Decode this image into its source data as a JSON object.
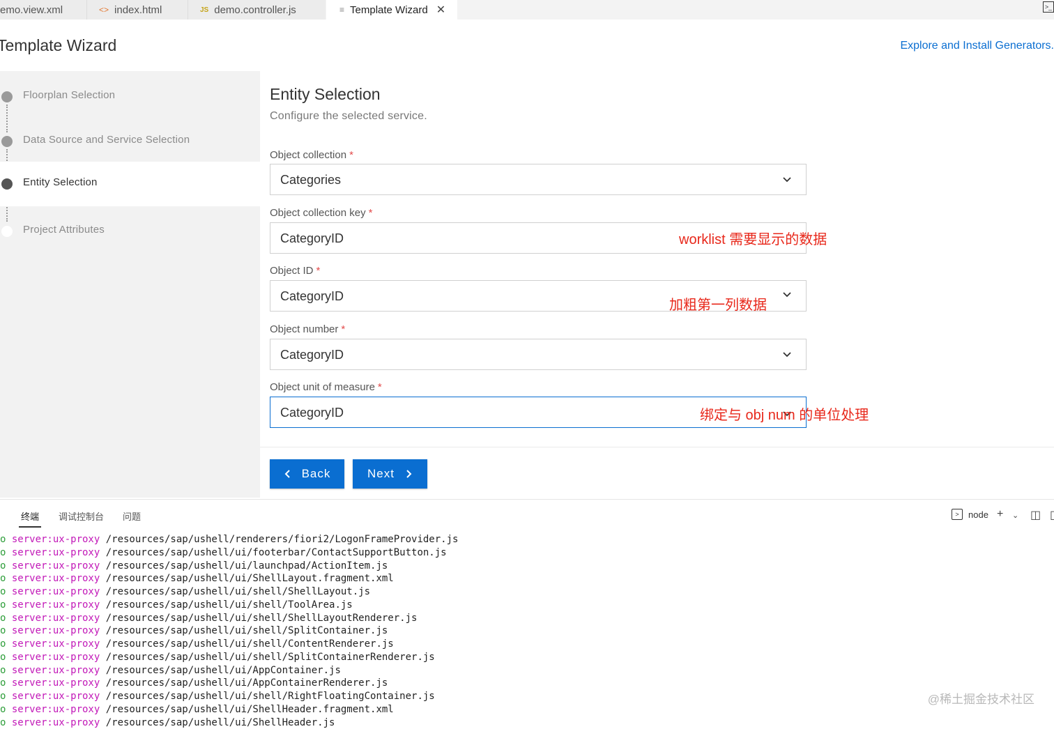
{
  "tabs": [
    {
      "label": "emo.view.xml",
      "icon": "xml-file-icon",
      "active": false
    },
    {
      "label": "index.html",
      "icon": "html-file-icon",
      "glyph": "<>",
      "active": false
    },
    {
      "label": "demo.controller.js",
      "icon": "js-file-icon",
      "glyph": "JS",
      "active": false
    },
    {
      "label": "Template Wizard",
      "icon": "wizard-file-icon",
      "glyph": "≡",
      "active": true
    }
  ],
  "header": {
    "title": "Template Wizard",
    "explore_link": "Explore and Install Generators."
  },
  "steps": [
    {
      "label": "Floorplan Selection",
      "state": "done"
    },
    {
      "label": "Data Source and Service Selection",
      "state": "done"
    },
    {
      "label": "Entity Selection",
      "state": "current"
    },
    {
      "label": "Project Attributes",
      "state": "pending"
    }
  ],
  "main": {
    "title": "Entity Selection",
    "subtitle": "Configure the selected service.",
    "fields": [
      {
        "label": "Object collection",
        "value": "Categories",
        "dropdown": true
      },
      {
        "label": "Object collection key",
        "value": "CategoryID",
        "dropdown": false
      },
      {
        "label": "Object ID",
        "value": "CategoryID",
        "dropdown": true
      },
      {
        "label": "Object number",
        "value": "CategoryID",
        "dropdown": true
      },
      {
        "label": "Object unit of measure",
        "value": "CategoryID",
        "dropdown": true
      }
    ],
    "required_mark": "*",
    "annotations": [
      "worklist 需要显示的数据",
      "加粗第一列数据",
      "绑定与 obj num 的单位处理"
    ],
    "back_label": "Back",
    "next_label": "Next"
  },
  "panel": {
    "tabs": [
      "终端",
      "调试控制台",
      "问题"
    ],
    "active_tab": "终端",
    "terminal_name": "node",
    "log_prefix": "o",
    "log_source": "server:ux-proxy",
    "log_lines": [
      "/resources/sap/ushell/renderers/fiori2/LogonFrameProvider.js",
      "/resources/sap/ushell/ui/footerbar/ContactSupportButton.js",
      "/resources/sap/ushell/ui/launchpad/ActionItem.js",
      "/resources/sap/ushell/ui/ShellLayout.fragment.xml",
      "/resources/sap/ushell/ui/shell/ShellLayout.js",
      "/resources/sap/ushell/ui/shell/ToolArea.js",
      "/resources/sap/ushell/ui/shell/ShellLayoutRenderer.js",
      "/resources/sap/ushell/ui/shell/SplitContainer.js",
      "/resources/sap/ushell/ui/shell/ContentRenderer.js",
      "/resources/sap/ushell/ui/shell/SplitContainerRenderer.js",
      "/resources/sap/ushell/ui/AppContainer.js",
      "/resources/sap/ushell/ui/AppContainerRenderer.js",
      "/resources/sap/ushell/ui/shell/RightFloatingContainer.js",
      "/resources/sap/ushell/ui/ShellHeader.fragment.xml",
      "/resources/sap/ushell/ui/ShellHeader.js"
    ]
  },
  "watermark": "@稀土掘金技术社区",
  "colors": {
    "accent": "#0a6ed1",
    "annotation": "#e8281b",
    "log_source": "#c218b8",
    "log_prefix": "#2e9e3a"
  }
}
